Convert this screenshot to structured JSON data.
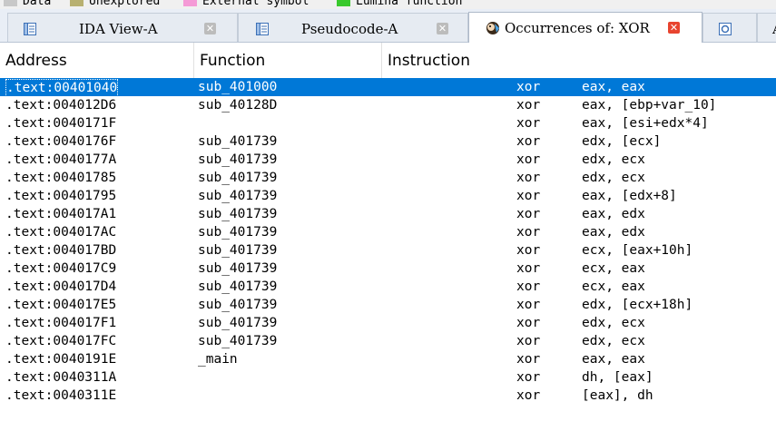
{
  "legend": [
    {
      "label": "Data",
      "color": "#c8c8c8"
    },
    {
      "label": "Unexplored",
      "color": "#b8b070"
    },
    {
      "label": "External symbol",
      "color": "#f59ad6"
    },
    {
      "label": "Lumina function",
      "color": "#39c92c"
    }
  ],
  "tabs": [
    {
      "label": "IDA View-A",
      "icon": "ida-view-icon",
      "active": false
    },
    {
      "label": "Pseudocode-A",
      "icon": "pseudocode-icon",
      "active": false
    },
    {
      "label": "Occurrences of: XOR",
      "icon": "occurrences-icon",
      "active": true
    },
    {
      "label": "",
      "icon": "hex-view-icon",
      "active": false
    },
    {
      "label": "",
      "icon": "structures-icon",
      "active": false
    }
  ],
  "columns": [
    "Address",
    "Function",
    "Instruction"
  ],
  "rows": [
    {
      "address": ".text:00401040",
      "function": "sub_401000",
      "mnemonic": "xor",
      "operands": "eax, eax"
    },
    {
      "address": ".text:004012D6",
      "function": "sub_40128D",
      "mnemonic": "xor",
      "operands": "eax, [ebp+var_10]"
    },
    {
      "address": ".text:0040171F",
      "function": "",
      "mnemonic": "xor",
      "operands": "eax, [esi+edx*4]"
    },
    {
      "address": ".text:0040176F",
      "function": "sub_401739",
      "mnemonic": "xor",
      "operands": "edx, [ecx]"
    },
    {
      "address": ".text:0040177A",
      "function": "sub_401739",
      "mnemonic": "xor",
      "operands": "edx, ecx"
    },
    {
      "address": ".text:00401785",
      "function": "sub_401739",
      "mnemonic": "xor",
      "operands": "edx, ecx"
    },
    {
      "address": ".text:00401795",
      "function": "sub_401739",
      "mnemonic": "xor",
      "operands": "eax, [edx+8]"
    },
    {
      "address": ".text:004017A1",
      "function": "sub_401739",
      "mnemonic": "xor",
      "operands": "eax, edx"
    },
    {
      "address": ".text:004017AC",
      "function": "sub_401739",
      "mnemonic": "xor",
      "operands": "eax, edx"
    },
    {
      "address": ".text:004017BD",
      "function": "sub_401739",
      "mnemonic": "xor",
      "operands": "ecx, [eax+10h]"
    },
    {
      "address": ".text:004017C9",
      "function": "sub_401739",
      "mnemonic": "xor",
      "operands": "ecx, eax"
    },
    {
      "address": ".text:004017D4",
      "function": "sub_401739",
      "mnemonic": "xor",
      "operands": "ecx, eax"
    },
    {
      "address": ".text:004017E5",
      "function": "sub_401739",
      "mnemonic": "xor",
      "operands": "edx, [ecx+18h]"
    },
    {
      "address": ".text:004017F1",
      "function": "sub_401739",
      "mnemonic": "xor",
      "operands": "edx, ecx"
    },
    {
      "address": ".text:004017FC",
      "function": "sub_401739",
      "mnemonic": "xor",
      "operands": "edx, ecx"
    },
    {
      "address": ".text:0040191E",
      "function": "_main",
      "mnemonic": "xor",
      "operands": "eax, eax"
    },
    {
      "address": ".text:0040311A",
      "function": "",
      "mnemonic": "xor",
      "operands": "dh, [eax]"
    },
    {
      "address": ".text:0040311E",
      "function": "",
      "mnemonic": "xor",
      "operands": "[eax], dh"
    }
  ],
  "selected_row": 0,
  "colors": {
    "selection": "#0078d7",
    "close_active": "#e8442f",
    "tab_bar": "#e9eef6"
  }
}
